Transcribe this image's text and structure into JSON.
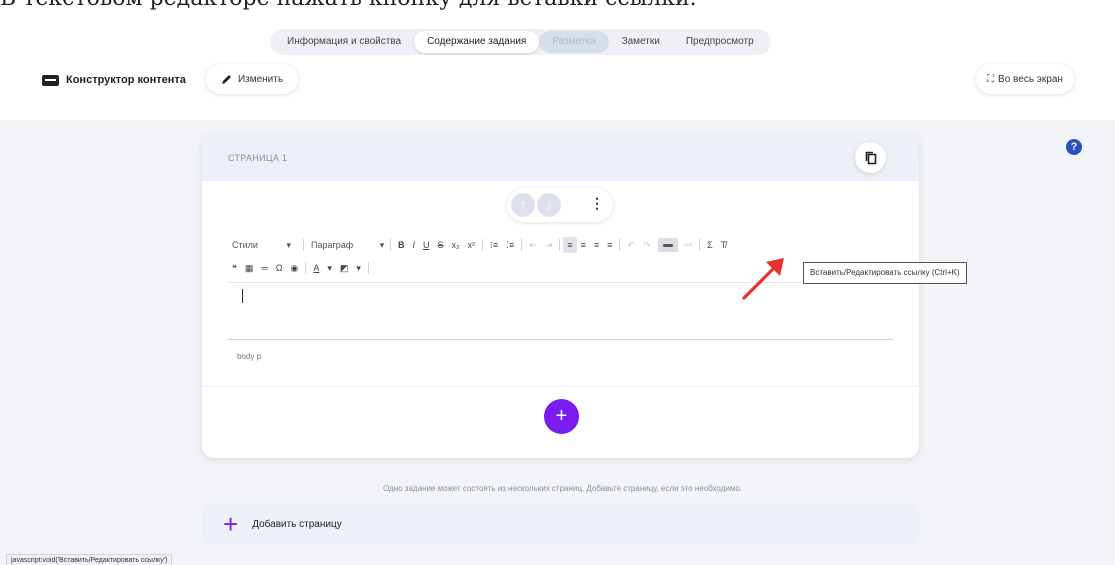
{
  "caption": "В текстовом редакторе нажать кнопку для вставки ссылки.",
  "tabs": [
    {
      "label": "Информация и свойства",
      "state": "normal"
    },
    {
      "label": "Содержание задания",
      "state": "active"
    },
    {
      "label": "Разметка",
      "state": "disabled"
    },
    {
      "label": "Заметки",
      "state": "normal"
    },
    {
      "label": "Предпросмотр",
      "state": "normal"
    }
  ],
  "header": {
    "title": "Конструктор контента",
    "edit_label": "Изменить",
    "fullscreen_icon": "⛶",
    "fullscreen_label": "Во весь экран"
  },
  "help_icon": "?",
  "card": {
    "page_label": "СТРАНИЦА 1",
    "move_up": "↑",
    "move_down": "↓",
    "more": "⋮",
    "add_block": "+"
  },
  "toolbar": {
    "styles": "Стили",
    "paragraph": "Параграф",
    "dropdown_arrow": "▾",
    "bold": "B",
    "italic": "I",
    "underline": "U",
    "strike": "S",
    "subscript": "x₂",
    "superscript": "x²",
    "numbered_list": "⁝≡",
    "bullet_list": "⁚≡",
    "outdent": "⇤",
    "indent": "⇥",
    "align_left": "≡",
    "align_center": "≡",
    "align_right": "≡",
    "justify": "≡",
    "undo": "↶",
    "redo": "↷",
    "unlink": "⚯",
    "sigma": "Σ",
    "clear_format": "T̸",
    "blockquote": "❝",
    "table": "▦",
    "hr": "═",
    "omega": "Ω",
    "media": "◉",
    "text_color": "A",
    "bg_color": "◩"
  },
  "status_path": "body  p",
  "tooltip": "Вставить/Редактировать ссылку (Ctrl+K)",
  "hint": "Одно задание может состоять из нескольких страниц. Добавьте страницу, если это необходимо.",
  "add_page": {
    "plus": "+",
    "label": "Добавить страницу"
  },
  "browser_status": "javascript:void('Вставить/Редактировать ссылку')",
  "colors": {
    "accent": "#7a1bf2",
    "help": "#2a4fbf",
    "arrow": "#e8312a",
    "background": "#f3f4f8"
  }
}
